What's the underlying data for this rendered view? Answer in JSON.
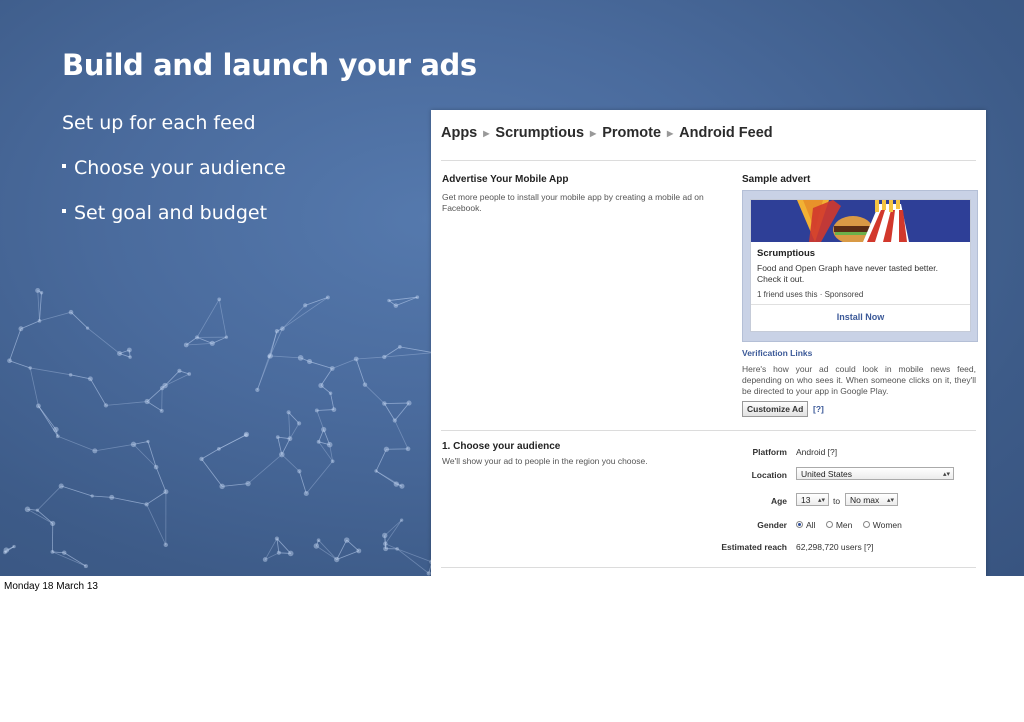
{
  "slide": {
    "title": "Build and launch your ads",
    "subtitle": "Set up for each feed",
    "bullets": [
      "Choose your audience",
      "Set goal and budget"
    ],
    "footer": "Monday 18 March 13"
  },
  "screenshot": {
    "breadcrumbs": [
      "Apps",
      "Scrumptious",
      "Promote",
      "Android Feed"
    ],
    "advertise": {
      "heading": "Advertise Your Mobile App",
      "text": "Get more people to install your mobile app by creating a mobile ad on Facebook."
    },
    "sample": {
      "heading": "Sample advert",
      "ad_title": "Scrumptious",
      "ad_text": "Food and Open Graph have never tasted better. Check it out.",
      "ad_friends": "1 friend uses this · Sponsored",
      "install_label": "Install Now",
      "verification_link": "Verification Links",
      "description": "Here's how your ad could look in mobile news feed, depending on who sees it. When someone clicks on it, they'll be directed to your app in Google Play.",
      "customize_label": "Customize Ad",
      "help": "[?]"
    },
    "audience": {
      "heading": "1. Choose your audience",
      "text": "We'll show your ad to people in the region you choose.",
      "platform_label": "Platform",
      "platform_value": "Android [?]",
      "location_label": "Location",
      "location_value": "United States",
      "age_label": "Age",
      "age_min": "13",
      "age_to": "to",
      "age_max": "No max",
      "gender_label": "Gender",
      "gender_options": [
        "All",
        "Men",
        "Women"
      ],
      "gender_selected": "All",
      "reach_label": "Estimated reach",
      "reach_value": "62,298,720 users [?]"
    }
  },
  "colors": {
    "slide_bg": "#4a6b9d",
    "facebook_blue": "#3b5998",
    "ad_image_bg": "#2e3f97"
  }
}
